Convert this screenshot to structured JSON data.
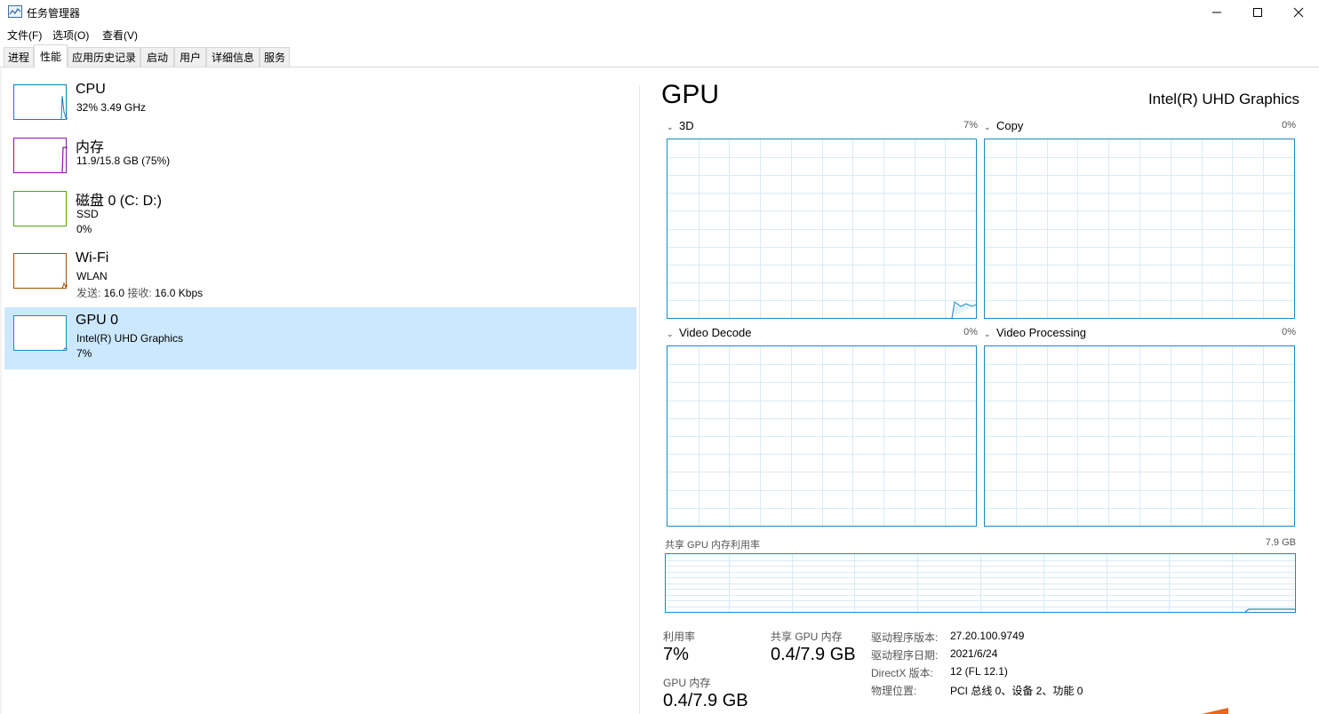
{
  "window": {
    "title": "任务管理器",
    "controls": {
      "minimize": "—",
      "maximize": "☐",
      "close": "✕"
    }
  },
  "menu": [
    "文件(F)",
    "选项(O)",
    "查看(V)"
  ],
  "tabs": [
    "进程",
    "性能",
    "应用历史记录",
    "启动",
    "用户",
    "详细信息",
    "服务"
  ],
  "active_tab": "性能",
  "resources": [
    {
      "name": "CPU",
      "line1": "32% 3.49 GHz",
      "line2": "",
      "color": "#117dbb"
    },
    {
      "name": "内存",
      "line1": "11.9/15.8 GB (75%)",
      "line2": "",
      "color": "#8b12ae"
    },
    {
      "name": "磁盘 0 (C: D:)",
      "line1": "SSD",
      "line2": "0%",
      "color": "#4da60c"
    },
    {
      "name": "Wi-Fi",
      "line1": "WLAN",
      "line2": {
        "send_label": "发送:",
        "send": "16.0",
        "recv_label": "接收:",
        "recv": "16.0 Kbps"
      },
      "color": "#a74f01"
    },
    {
      "name": "GPU 0",
      "line1": "Intel(R) UHD Graphics",
      "line2": "7%",
      "color": "#1a8ac4",
      "selected": true
    }
  ],
  "gpu": {
    "title": "GPU",
    "model": "Intel(R) UHD Graphics",
    "engines": [
      {
        "name": "3D",
        "percent": "7%"
      },
      {
        "name": "Copy",
        "percent": "0%"
      },
      {
        "name": "Video Decode",
        "percent": "0%"
      },
      {
        "name": "Video Processing",
        "percent": "0%"
      }
    ],
    "shared_memory": {
      "label": "共享 GPU 内存利用率",
      "max": "7.9 GB"
    },
    "stats": {
      "utilization_label": "利用率",
      "utilization": "7%",
      "shared_mem_label": "共享 GPU 内存",
      "shared_mem": "0.4/7.9 GB",
      "gpu_mem_label": "GPU 内存",
      "gpu_mem": "0.4/7.9 GB"
    },
    "info": [
      {
        "label": "驱动程序版本:",
        "value": "27.20.100.9749"
      },
      {
        "label": "驱动程序日期:",
        "value": "2021/6/24"
      },
      {
        "label": "DirectX 版本:",
        "value": "12 (FL 12.1)"
      },
      {
        "label": "物理位置:",
        "value": "PCI 总线 0、设备 2、功能 0"
      }
    ]
  }
}
